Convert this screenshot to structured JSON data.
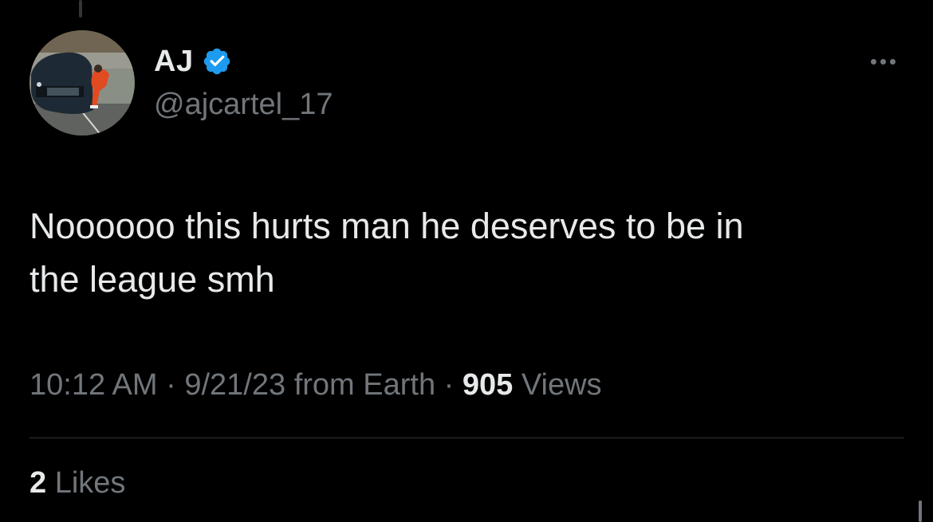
{
  "author": {
    "display_name": "AJ",
    "handle": "@ajcartel_17",
    "verified": true,
    "verified_icon": "verified-badge-icon",
    "verified_color": "#1d9bf0"
  },
  "tweet": {
    "text_line1": "Noooooo this hurts man he deserves to be in",
    "text_line2": "the league smh"
  },
  "meta": {
    "time": "10:12 AM",
    "separator": "·",
    "date": "9/21/23",
    "source": "from Earth",
    "views_count": "905",
    "views_label": "Views"
  },
  "engagement": {
    "likes_count": "2",
    "likes_label": "Likes"
  },
  "icons": {
    "more": "more-horizontal-icon"
  },
  "colors": {
    "background": "#000000",
    "primary_text": "#e7e9ea",
    "secondary_text": "#71767b",
    "divider": "#2f3336"
  }
}
